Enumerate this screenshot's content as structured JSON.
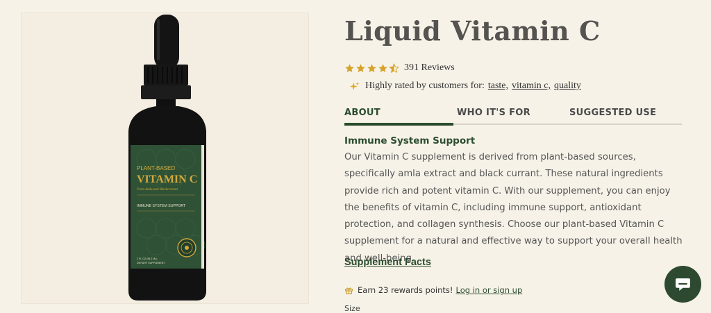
{
  "product": {
    "title": "Liquid Vitamin C",
    "rating": 4.5,
    "review_count": "391 Reviews"
  },
  "label": {
    "line1": "PLANT-BASED",
    "line2": "VITAMIN C",
    "line3": "From Amla and Blackcurrant",
    "line4": "IMMUNE SYSTEM SUPPORT",
    "line5": "2 FL OZ (59.2 ML)",
    "line6": "DIETARY SUPPLEMENT"
  },
  "highlights": {
    "prefix": "Highly rated by customers for:",
    "tags": [
      "taste,",
      "vitamin c,",
      "quality"
    ]
  },
  "tabs": [
    {
      "label": "ABOUT",
      "active": true
    },
    {
      "label": "WHO IT'S FOR",
      "active": false
    },
    {
      "label": "SUGGESTED USE",
      "active": false
    }
  ],
  "about": {
    "heading": "Immune System Support",
    "body": "Our Vitamin C supplement is derived from plant-based sources, specifically amla extract and black currant. These natural ingredients provide rich and potent vitamin C. With our supplement, you can enjoy the benefits of vitamin C, including immune support, antioxidant protection, and collagen synthesis. Choose our plant-based Vitamin C supplement for a natural and effective way to support your overall health and well-being."
  },
  "supplement_facts_label": "Supplement Facts",
  "rewards": {
    "text": "Earn 23 rewards points!",
    "login_label": "Log in or sign up"
  },
  "size_label": "Size",
  "colors": {
    "accent": "#2b4d2f",
    "star": "#d4a429",
    "background": "#f7f2e8",
    "label_green": "#2f5236",
    "label_gold": "#d4a93c"
  }
}
